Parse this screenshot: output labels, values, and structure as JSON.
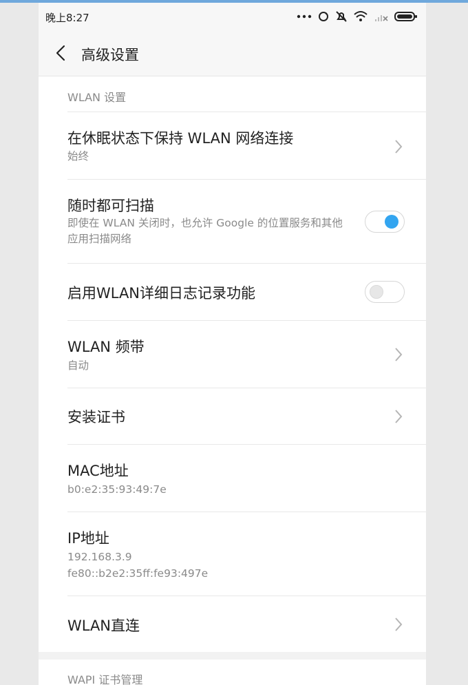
{
  "status_bar": {
    "time": "晚上8:27",
    "icons": [
      "more-dots-icon",
      "sync-icon",
      "notifications-off-icon",
      "wifi-icon",
      "cellular-signal-off-icon",
      "battery-icon"
    ]
  },
  "app_bar": {
    "title": "高级设置"
  },
  "sections": {
    "wlan_settings": "WLAN 设置",
    "wapi_cert": "WAPI 证书管理"
  },
  "rows": {
    "keep_wifi_sleep": {
      "title": "在休眠状态下保持 WLAN 网络连接",
      "subtitle": "始终"
    },
    "always_scan": {
      "title": "随时都可扫描",
      "subtitle": "即使在 WLAN 关闭时，也允许 Google 的位置服务和其他应用扫描网络",
      "enabled": true
    },
    "verbose_logging": {
      "title": "启用WLAN详细日志记录功能",
      "enabled": false
    },
    "wlan_band": {
      "title": "WLAN 频带",
      "subtitle": "自动"
    },
    "install_certs": {
      "title": "安装证书"
    },
    "mac_address": {
      "title": "MAC地址",
      "value": "b0:e2:35:93:49:7e"
    },
    "ip_address": {
      "title": "IP地址",
      "value_v4": "192.168.3.9",
      "value_v6": "fe80::b2e2:35ff:fe93:497e"
    },
    "wifi_direct": {
      "title": "WLAN直连"
    }
  },
  "colors": {
    "accent": "#33a5f0",
    "toggle_off": "#e7e7e7"
  }
}
